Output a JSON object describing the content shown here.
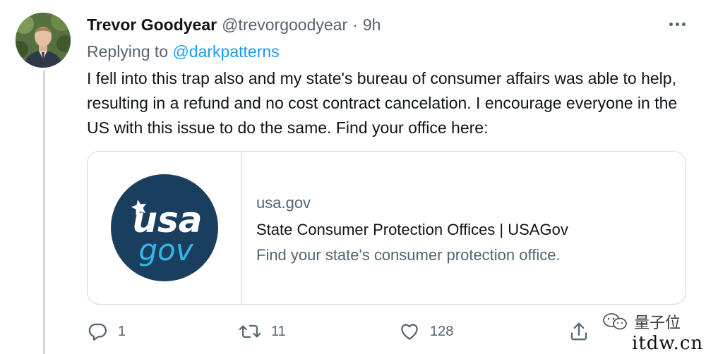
{
  "author": {
    "display_name": "Trevor Goodyear",
    "handle": "@trevorgoodyear",
    "separator": "·",
    "time": "9h"
  },
  "reply": {
    "prefix": "Replying to ",
    "mention": "@darkpatterns"
  },
  "body": "I fell into this trap also and my state's bureau of consumer affairs was able to help, resulting in a refund and no cost contract cancelation. I encourage everyone in the US with this issue to do the same. Find your office here:",
  "card": {
    "logo_text_top": "usa",
    "logo_text_bottom": "gov",
    "domain": "usa.gov",
    "title": "State Consumer Protection Offices | USAGov",
    "description": "Find your state's consumer protection office."
  },
  "actions": {
    "reply_count": "1",
    "retweet_count": "11",
    "like_count": "128"
  },
  "icons": {
    "reply": "reply-icon",
    "retweet": "retweet-icon",
    "like": "heart-icon",
    "share": "share-icon",
    "more": "more-icon"
  },
  "watermark": {
    "brand": "量子位",
    "site": "itdw.cn"
  },
  "colors": {
    "link": "#1d9bf0",
    "secondary_text": "#536471",
    "border": "#cfd9de",
    "logo_bg": "#1a3e5e",
    "logo_accent": "#34b6e4"
  }
}
